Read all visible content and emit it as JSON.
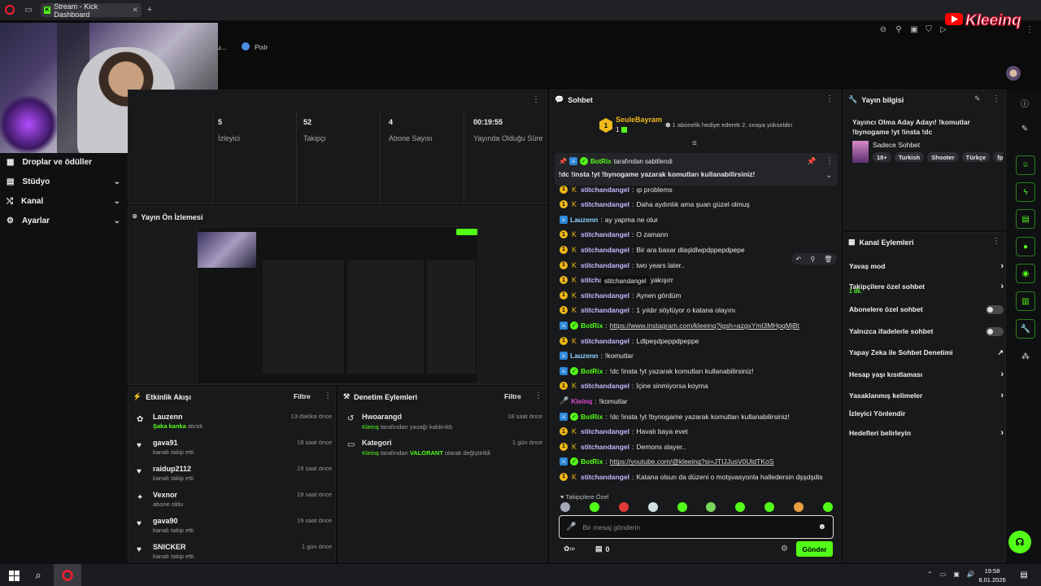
{
  "browser": {
    "tab_title": "Stream - Kick Dashboard",
    "bookmarks": [
      "ou...",
      "Pixlr"
    ]
  },
  "watermark": {
    "text": "Kleeinq"
  },
  "sidebar": {
    "items": [
      {
        "label": "Droplar ve ödüller",
        "icon": "gift-icon"
      },
      {
        "label": "Stüdyo",
        "icon": "grid-icon"
      },
      {
        "label": "Kanal",
        "icon": "share-icon"
      },
      {
        "label": "Ayarlar",
        "icon": "gear-icon"
      }
    ]
  },
  "stats": [
    {
      "value": "5",
      "label": "İzleyici"
    },
    {
      "value": "52",
      "label": "Takipçi"
    },
    {
      "value": "4",
      "label": "Abone Sayısı"
    },
    {
      "value": "00:19:55",
      "label": "Yayında Olduğu Süre"
    }
  ],
  "preview": {
    "title": "Yayın Ön İzlemesi"
  },
  "activity": {
    "title": "Etkinlik Akışı",
    "filter": "Filtre",
    "items": [
      {
        "name": "Lauzenn",
        "highlight": "Şaka kanka",
        "sub": " alındı",
        "time": "13 dakika önce",
        "icon": "emote-icon"
      },
      {
        "name": "gava91",
        "sub": "kanalı takip etti",
        "time": "18 saat önce",
        "icon": "heart-icon"
      },
      {
        "name": "raidup2112",
        "sub": "kanalı takip etti",
        "time": "19 saat önce",
        "icon": "heart-icon"
      },
      {
        "name": "Vexnor",
        "sub": "abone oldu",
        "time": "19 saat önce",
        "icon": "star-icon"
      },
      {
        "name": "gava90",
        "sub": "kanalı takip etti",
        "time": "19 saat önce",
        "icon": "heart-icon"
      },
      {
        "name": "SNICKER",
        "sub": "kanalı takip etti",
        "time": "1 gün önce",
        "icon": "heart-icon"
      }
    ]
  },
  "moderation": {
    "title": "Denetim Eylemleri",
    "filter": "Filtre",
    "items": [
      {
        "name": "Hwoarangd",
        "actor": "Kleinq",
        "text": " tarafından yasağı kaldırıldı",
        "time": "18 saat önce"
      },
      {
        "name": "Kategori",
        "actor": "Kleinq",
        "text": " tarafından ",
        "highlight": "VALORANT",
        "text2": " olarak değiştirildi",
        "time": "1 gün önce"
      }
    ]
  },
  "chat": {
    "title": "Sohbet",
    "gift_user": "SeuleBayram",
    "gift_count": "1",
    "gift_text": "1 abonelik hediye ederek 2. sıraya yükseldin",
    "pinned_by": "BotRix",
    "pinned_by_suffix": " tarafından sabitlendi",
    "pinned_text": "!dc !insta !yt !bynogame yazarak komutları kullanabilirsiniz!",
    "messages": [
      {
        "user": "stitchandangel",
        "type": "stitch",
        "text": "ıp problems"
      },
      {
        "user": "stitchandangel",
        "type": "stitch",
        "text": "Daha aydınlık ama şuan güzel olmuş"
      },
      {
        "user": "Lauzenn",
        "type": "lau",
        "text": "ay yapma ne olur"
      },
      {
        "user": "stitchandangel",
        "type": "stitch",
        "text": "O zamann"
      },
      {
        "user": "stitchandangel",
        "type": "stitch",
        "text": "Bir ara basar dlaşldlwpdppepdpepe"
      },
      {
        "user": "stitchandangel",
        "type": "stitch",
        "text": "two years later.."
      },
      {
        "user": "stitchandangel",
        "type": "stitch",
        "text": "şıklı yakışırr"
      },
      {
        "user": "stitchandangel",
        "type": "stitch",
        "text": "Aynen gördüm"
      },
      {
        "user": "stitchandangel",
        "type": "stitch",
        "text": "1 yıldır söylüyor o katana olayını"
      },
      {
        "user": "BotRix",
        "type": "bot",
        "text": "https://www.instagram.com/kleeinq?igsh=azgxYml3MHpqMjBt",
        "link": true
      },
      {
        "user": "stitchandangel",
        "type": "stitch",
        "text": "Ldlpeşdpeppdpeppe"
      },
      {
        "user": "Lauzenn",
        "type": "lau",
        "text": "!komutlar"
      },
      {
        "user": "BotRix",
        "type": "bot",
        "text": "!dc !insta !yt yazarak komutları kullanabilirsiniz!"
      },
      {
        "user": "stitchandangel",
        "type": "stitch",
        "text": "İçine sinmiyorsa koyma"
      },
      {
        "user": "Kleinq",
        "type": "kle",
        "text": "!komutlar"
      },
      {
        "user": "BotRix",
        "type": "bot",
        "text": "!dc !insta !yt !bynogame yazarak komutları kullanabilirsiniz!"
      },
      {
        "user": "stitchandangel",
        "type": "stitch",
        "text": "Havalı baya evet"
      },
      {
        "user": "stitchandangel",
        "type": "stitch",
        "text": "Demons slayer.."
      },
      {
        "user": "BotRix",
        "type": "bot",
        "text": "https://youtube.com/@kleeinq?si=JTIJJusV0UldTKoS",
        "link": true
      },
      {
        "user": "stitchandangel",
        "type": "stitch",
        "text": "Katana olsun da düzeni o motşvasyonla halledersin dşşdşdis"
      }
    ],
    "hover_tooltip": "stitchandangel",
    "followers_only": "Takipçilere Özel",
    "input_placeholder": "Bir mesaj gönderin",
    "points": "0",
    "send_label": "Gönder"
  },
  "stream_info": {
    "title": "Yayın bilgisi",
    "stream_title": "Yayıncı Olma Aday Adayı! !komutlar !bynogame !yt !insta !dc",
    "category": "Sadece Sohbet",
    "tags": [
      "18+",
      "Turkish",
      "Shooter",
      "Türkçe",
      "fp"
    ]
  },
  "channel_actions": {
    "title": "Kanal Eylemleri",
    "items": [
      {
        "label": "Yavaş mod",
        "control": "chevron"
      },
      {
        "label": "Takipçilere özel sohbet",
        "sub": "1 dk.",
        "control": "chevron"
      },
      {
        "label": "Abonelere özel sohbet",
        "control": "toggle"
      },
      {
        "label": "Yalnızca ifadelerle sohbet",
        "control": "toggle"
      },
      {
        "label": "Yapay Zeka ile Sohbet Denetimi",
        "control": "external"
      },
      {
        "label": "Hesap yaşı kısıtlaması",
        "control": "chevron"
      },
      {
        "label": "Yasaklanmış kelimeler",
        "control": "chevron"
      },
      {
        "label": "İzleyici Yönlendir",
        "control": "none"
      },
      {
        "label": "Hedefleri belirleyin",
        "control": "chevron"
      }
    ]
  },
  "taskbar": {
    "time": "19:58",
    "date": "8.01.2026"
  },
  "colors": {
    "accent": "#53fc18",
    "bg": "#0f1012",
    "panel": "#18191b"
  }
}
